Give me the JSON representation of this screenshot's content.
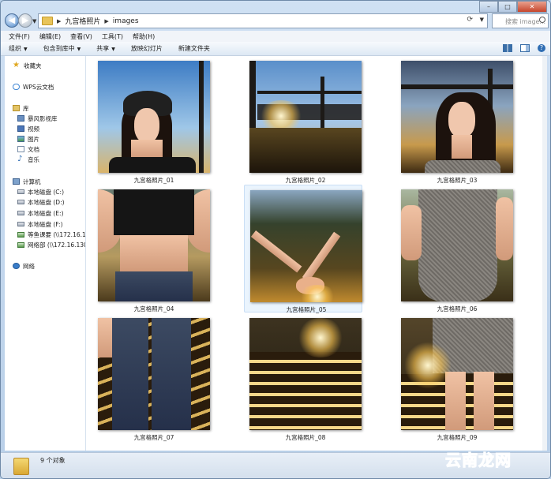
{
  "window": {
    "breadcrumb": [
      "九宫格照片",
      "images"
    ],
    "search_placeholder": "搜索 image...",
    "controls": {
      "minimize": "–",
      "maximize": "□",
      "close": "✕"
    }
  },
  "menu": [
    "文件(F)",
    "编辑(E)",
    "查看(V)",
    "工具(T)",
    "帮助(H)"
  ],
  "toolbar": {
    "organize": "组织",
    "include_in_library": "包含到库中",
    "share": "共享",
    "slideshow": "放映幻灯片",
    "new_folder": "新建文件夹"
  },
  "nav": {
    "favorites": "收藏夹",
    "wps_cloud": "WPS云文档",
    "libraries": "库",
    "library_items": [
      "暴风影视库",
      "视频",
      "图片",
      "文档",
      "音乐"
    ],
    "computer": "计算机",
    "drives": [
      "本地磁盘 (C:)",
      "本地磁盘 (D:)",
      "本地磁盘 (E:)",
      "本地磁盘 (F:)"
    ],
    "net_drives": [
      "等鱼课要 (\\\\172.16.130",
      "网络部 (\\\\172.16.130.1"
    ],
    "network": "网络"
  },
  "files": [
    {
      "name": "九宫格照片_01"
    },
    {
      "name": "九宫格照片_02"
    },
    {
      "name": "九宫格照片_03"
    },
    {
      "name": "九宫格照片_04"
    },
    {
      "name": "九宫格照片_05",
      "selected": true
    },
    {
      "name": "九宫格照片_06"
    },
    {
      "name": "九宫格照片_07"
    },
    {
      "name": "九宫格照片_08"
    },
    {
      "name": "九宫格照片_09"
    }
  ],
  "status": {
    "count": "9 个对象"
  },
  "watermark": "云南龙网",
  "colors": {
    "accent": "#2f6db3",
    "window_frame": "#b8cfe8",
    "watermark": "#e62b2b"
  }
}
